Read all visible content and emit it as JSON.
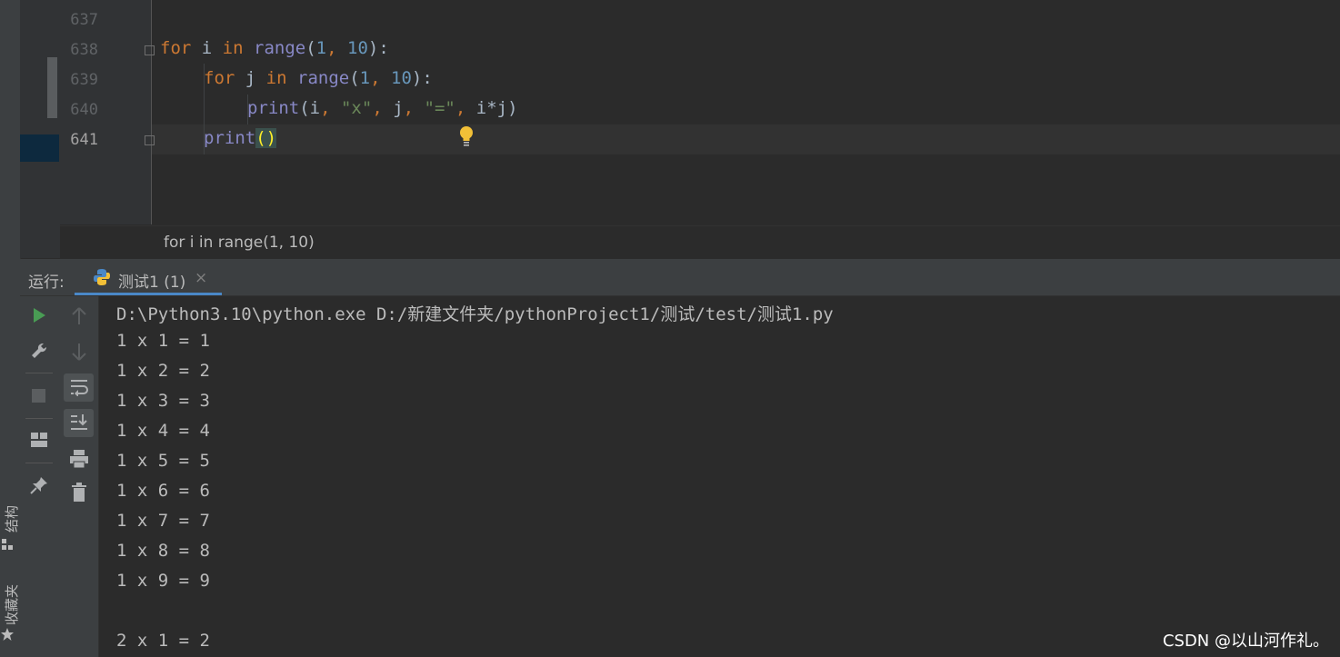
{
  "editor": {
    "line_numbers": [
      "637",
      "638",
      "639",
      "640",
      "641"
    ],
    "current_line": "641",
    "code": {
      "l638": {
        "kw_for": "for",
        "var": " i ",
        "kw_in": "in",
        "sp": " ",
        "fn": "range",
        "open": "(",
        "n1": "1",
        "comma": ", ",
        "n2": "10",
        "close": "):"
      },
      "l639": {
        "kw_for": "for",
        "var": " j ",
        "kw_in": "in",
        "sp": " ",
        "fn": "range",
        "open": "(",
        "n1": "1",
        "comma": ", ",
        "n2": "10",
        "close": "):"
      },
      "l640": {
        "fn": "print",
        "a1": "(i",
        "c1": ", ",
        "s1": "\"x\"",
        "c2": ", ",
        "a2": "j",
        "c3": ", ",
        "s2": "\"=\"",
        "c4": ", ",
        "a3": "i*j)"
      },
      "l641": {
        "fn": "print",
        "parens": "()"
      }
    },
    "breadcrumb": "for i in range(1, 10)"
  },
  "run_panel": {
    "label": "运行:",
    "tab_title": "测试1 (1)",
    "tab_close": "×",
    "toolbar_icons": [
      "run-icon",
      "wrench-icon",
      "stop-icon",
      "layout-icon",
      "pin-icon",
      "up-arrow-icon",
      "down-arrow-icon",
      "soft-wrap-icon",
      "scroll-to-end-icon",
      "print-icon",
      "trash-icon"
    ],
    "console": [
      "D:\\Python3.10\\python.exe D:/新建文件夹/pythonProject1/测试/test/测试1.py",
      "1 x 1 = 1",
      "1 x 2 = 2",
      "1 x 3 = 3",
      "1 x 4 = 4",
      "1 x 5 = 5",
      "1 x 6 = 6",
      "1 x 7 = 7",
      "1 x 8 = 8",
      "1 x 9 = 9",
      "",
      "2 x 1 = 2"
    ]
  },
  "side_tabs": {
    "structure": "结构",
    "favorites": "收藏夹"
  },
  "watermark": "CSDN @以山河作礼。",
  "colors": {
    "keyword": "#cc7832",
    "builtin": "#8888c6",
    "number": "#6897bb",
    "string": "#6a8759",
    "run_green": "#499c54",
    "tab_underline": "#4a88c7"
  }
}
